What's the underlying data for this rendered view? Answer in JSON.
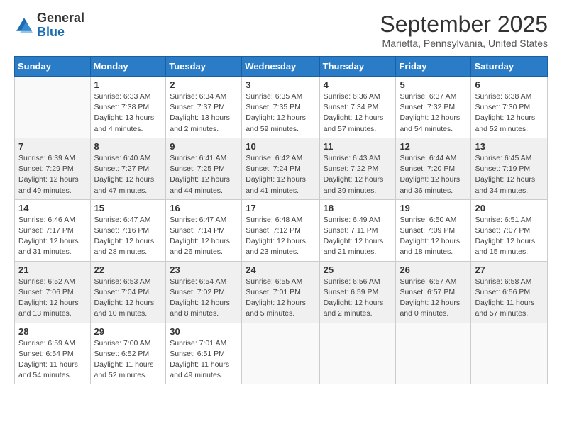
{
  "header": {
    "logo_general": "General",
    "logo_blue": "Blue",
    "month_title": "September 2025",
    "location": "Marietta, Pennsylvania, United States"
  },
  "days_of_week": [
    "Sunday",
    "Monday",
    "Tuesday",
    "Wednesday",
    "Thursday",
    "Friday",
    "Saturday"
  ],
  "weeks": [
    [
      {
        "day": "",
        "empty": true
      },
      {
        "day": "1",
        "sunrise": "Sunrise: 6:33 AM",
        "sunset": "Sunset: 7:38 PM",
        "daylight": "Daylight: 13 hours and 4 minutes."
      },
      {
        "day": "2",
        "sunrise": "Sunrise: 6:34 AM",
        "sunset": "Sunset: 7:37 PM",
        "daylight": "Daylight: 13 hours and 2 minutes."
      },
      {
        "day": "3",
        "sunrise": "Sunrise: 6:35 AM",
        "sunset": "Sunset: 7:35 PM",
        "daylight": "Daylight: 12 hours and 59 minutes."
      },
      {
        "day": "4",
        "sunrise": "Sunrise: 6:36 AM",
        "sunset": "Sunset: 7:34 PM",
        "daylight": "Daylight: 12 hours and 57 minutes."
      },
      {
        "day": "5",
        "sunrise": "Sunrise: 6:37 AM",
        "sunset": "Sunset: 7:32 PM",
        "daylight": "Daylight: 12 hours and 54 minutes."
      },
      {
        "day": "6",
        "sunrise": "Sunrise: 6:38 AM",
        "sunset": "Sunset: 7:30 PM",
        "daylight": "Daylight: 12 hours and 52 minutes."
      }
    ],
    [
      {
        "day": "7",
        "sunrise": "Sunrise: 6:39 AM",
        "sunset": "Sunset: 7:29 PM",
        "daylight": "Daylight: 12 hours and 49 minutes."
      },
      {
        "day": "8",
        "sunrise": "Sunrise: 6:40 AM",
        "sunset": "Sunset: 7:27 PM",
        "daylight": "Daylight: 12 hours and 47 minutes."
      },
      {
        "day": "9",
        "sunrise": "Sunrise: 6:41 AM",
        "sunset": "Sunset: 7:25 PM",
        "daylight": "Daylight: 12 hours and 44 minutes."
      },
      {
        "day": "10",
        "sunrise": "Sunrise: 6:42 AM",
        "sunset": "Sunset: 7:24 PM",
        "daylight": "Daylight: 12 hours and 41 minutes."
      },
      {
        "day": "11",
        "sunrise": "Sunrise: 6:43 AM",
        "sunset": "Sunset: 7:22 PM",
        "daylight": "Daylight: 12 hours and 39 minutes."
      },
      {
        "day": "12",
        "sunrise": "Sunrise: 6:44 AM",
        "sunset": "Sunset: 7:20 PM",
        "daylight": "Daylight: 12 hours and 36 minutes."
      },
      {
        "day": "13",
        "sunrise": "Sunrise: 6:45 AM",
        "sunset": "Sunset: 7:19 PM",
        "daylight": "Daylight: 12 hours and 34 minutes."
      }
    ],
    [
      {
        "day": "14",
        "sunrise": "Sunrise: 6:46 AM",
        "sunset": "Sunset: 7:17 PM",
        "daylight": "Daylight: 12 hours and 31 minutes."
      },
      {
        "day": "15",
        "sunrise": "Sunrise: 6:47 AM",
        "sunset": "Sunset: 7:16 PM",
        "daylight": "Daylight: 12 hours and 28 minutes."
      },
      {
        "day": "16",
        "sunrise": "Sunrise: 6:47 AM",
        "sunset": "Sunset: 7:14 PM",
        "daylight": "Daylight: 12 hours and 26 minutes."
      },
      {
        "day": "17",
        "sunrise": "Sunrise: 6:48 AM",
        "sunset": "Sunset: 7:12 PM",
        "daylight": "Daylight: 12 hours and 23 minutes."
      },
      {
        "day": "18",
        "sunrise": "Sunrise: 6:49 AM",
        "sunset": "Sunset: 7:11 PM",
        "daylight": "Daylight: 12 hours and 21 minutes."
      },
      {
        "day": "19",
        "sunrise": "Sunrise: 6:50 AM",
        "sunset": "Sunset: 7:09 PM",
        "daylight": "Daylight: 12 hours and 18 minutes."
      },
      {
        "day": "20",
        "sunrise": "Sunrise: 6:51 AM",
        "sunset": "Sunset: 7:07 PM",
        "daylight": "Daylight: 12 hours and 15 minutes."
      }
    ],
    [
      {
        "day": "21",
        "sunrise": "Sunrise: 6:52 AM",
        "sunset": "Sunset: 7:06 PM",
        "daylight": "Daylight: 12 hours and 13 minutes."
      },
      {
        "day": "22",
        "sunrise": "Sunrise: 6:53 AM",
        "sunset": "Sunset: 7:04 PM",
        "daylight": "Daylight: 12 hours and 10 minutes."
      },
      {
        "day": "23",
        "sunrise": "Sunrise: 6:54 AM",
        "sunset": "Sunset: 7:02 PM",
        "daylight": "Daylight: 12 hours and 8 minutes."
      },
      {
        "day": "24",
        "sunrise": "Sunrise: 6:55 AM",
        "sunset": "Sunset: 7:01 PM",
        "daylight": "Daylight: 12 hours and 5 minutes."
      },
      {
        "day": "25",
        "sunrise": "Sunrise: 6:56 AM",
        "sunset": "Sunset: 6:59 PM",
        "daylight": "Daylight: 12 hours and 2 minutes."
      },
      {
        "day": "26",
        "sunrise": "Sunrise: 6:57 AM",
        "sunset": "Sunset: 6:57 PM",
        "daylight": "Daylight: 12 hours and 0 minutes."
      },
      {
        "day": "27",
        "sunrise": "Sunrise: 6:58 AM",
        "sunset": "Sunset: 6:56 PM",
        "daylight": "Daylight: 11 hours and 57 minutes."
      }
    ],
    [
      {
        "day": "28",
        "sunrise": "Sunrise: 6:59 AM",
        "sunset": "Sunset: 6:54 PM",
        "daylight": "Daylight: 11 hours and 54 minutes."
      },
      {
        "day": "29",
        "sunrise": "Sunrise: 7:00 AM",
        "sunset": "Sunset: 6:52 PM",
        "daylight": "Daylight: 11 hours and 52 minutes."
      },
      {
        "day": "30",
        "sunrise": "Sunrise: 7:01 AM",
        "sunset": "Sunset: 6:51 PM",
        "daylight": "Daylight: 11 hours and 49 minutes."
      },
      {
        "day": "",
        "empty": true
      },
      {
        "day": "",
        "empty": true
      },
      {
        "day": "",
        "empty": true
      },
      {
        "day": "",
        "empty": true
      }
    ]
  ]
}
